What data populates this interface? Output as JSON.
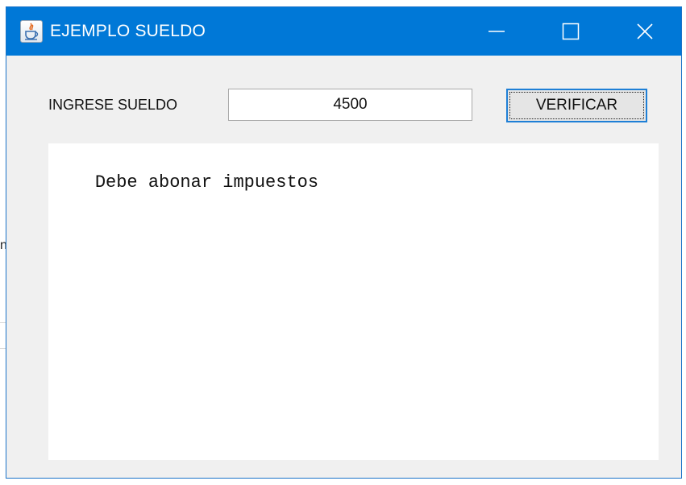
{
  "window": {
    "title": "EJEMPLO SUELDO",
    "accent_color": "#0078d7",
    "icon": "java-icon",
    "controls": {
      "minimize_icon": "minimize-icon",
      "maximize_icon": "maximize-icon",
      "close_icon": "close-icon"
    }
  },
  "form": {
    "salary_label": "INGRESE SUELDO",
    "salary_value": "4500",
    "verify_button_label": "VERIFICAR"
  },
  "output": {
    "text": "Debe abonar impuestos"
  },
  "background": {
    "fragment_text": "n"
  }
}
